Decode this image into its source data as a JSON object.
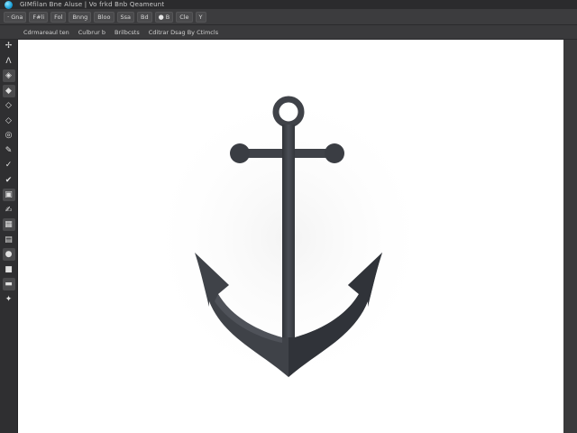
{
  "titlebar": {
    "title": "GIMfilan Bne Aluse | Vo frkd Bnb Qeameunt"
  },
  "menubar": {
    "items": [
      {
        "label": "Gna",
        "icon": "·"
      },
      {
        "label": "F#li",
        "icon": ""
      },
      {
        "label": "Fol",
        "icon": ""
      },
      {
        "label": "Bnng",
        "icon": ""
      },
      {
        "label": "Bloo",
        "icon": ""
      },
      {
        "label": "Ssa",
        "icon": ""
      },
      {
        "label": "Bd",
        "icon": ""
      },
      {
        "label": "B",
        "icon": "●"
      },
      {
        "label": "Cle",
        "icon": ""
      },
      {
        "label": "Y",
        "icon": ""
      }
    ]
  },
  "optionsbar": {
    "items": [
      "Cdrmareaul ten",
      "Culbrur b",
      "Brilbcsts",
      "Cditrar Dsag By Ctimcls"
    ]
  },
  "toolbar": {
    "tools": [
      {
        "icon": "move-icon",
        "glyph": "✢"
      },
      {
        "icon": "path-icon",
        "glyph": "Λ"
      },
      {
        "icon": "select-icon",
        "glyph": "◈"
      },
      {
        "icon": "lasso-icon",
        "glyph": "◆"
      },
      {
        "icon": "fuzzy-select-icon",
        "glyph": "◇"
      },
      {
        "icon": "crop-icon",
        "glyph": "◇"
      },
      {
        "icon": "transform-icon",
        "glyph": "◎"
      },
      {
        "icon": "pencil-icon",
        "glyph": "✎"
      },
      {
        "icon": "brush-icon",
        "glyph": "✓"
      },
      {
        "icon": "airbrush-icon",
        "glyph": "✔"
      },
      {
        "icon": "eraser-icon",
        "glyph": "▣"
      },
      {
        "icon": "ink-icon",
        "glyph": "✍"
      },
      {
        "icon": "clone-icon",
        "glyph": "▦"
      },
      {
        "icon": "heal-icon",
        "glyph": "▤"
      },
      {
        "icon": "smudge-icon",
        "glyph": "●"
      },
      {
        "icon": "dodge-icon",
        "glyph": "■"
      },
      {
        "icon": "gradient-icon",
        "glyph": "▬"
      },
      {
        "icon": "text-icon",
        "glyph": "✦"
      }
    ]
  },
  "colors": {
    "anchor_fill": "#3f4248",
    "anchor_shadow": "#2c2e33",
    "anchor_highlight": "#5a5e66",
    "canvas": "#ffffff",
    "ui_dark": "#353537"
  }
}
